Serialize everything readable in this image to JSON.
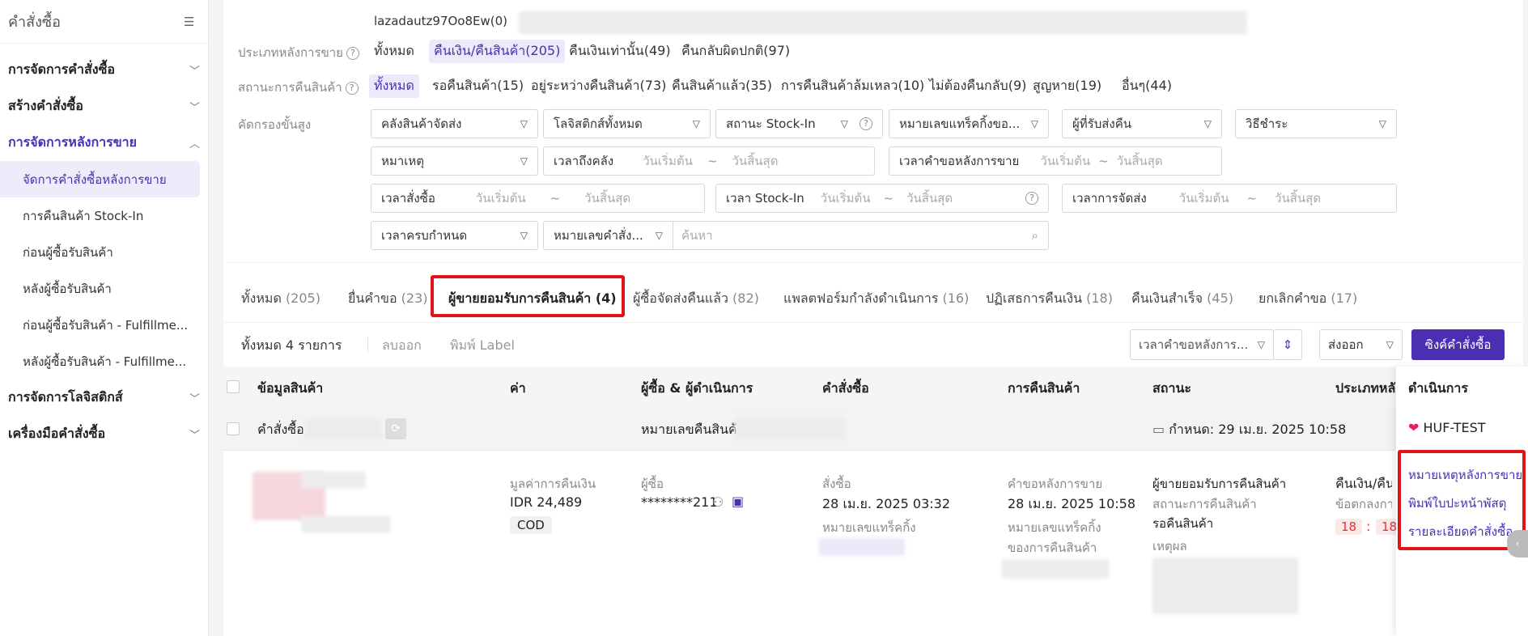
{
  "sidebar": {
    "title": "คำสั่งซื้อ",
    "groups": [
      {
        "label": "การจัดการคำสั่งซื้อ"
      },
      {
        "label": "สร้างคำสั่งซื้อ"
      },
      {
        "label": "การจัดการหลังการขาย"
      },
      {
        "label": "การจัดการโลจิสติกส์"
      },
      {
        "label": "เครื่องมือคำสั่งซื้อ"
      }
    ],
    "items": [
      {
        "label": "จัดการคำสั่งซื้อหลังการขาย"
      },
      {
        "label": "การคืนสินค้า Stock-In"
      },
      {
        "label": "ก่อนผู้ซื้อรับสินค้า"
      },
      {
        "label": "หลังผู้ซื้อรับสินค้า"
      },
      {
        "label": "ก่อนผู้ซื้อรับสินค้า - Fulfillme..."
      },
      {
        "label": "หลังผู้ซื้อรับสินค้า - Fulfillme..."
      }
    ]
  },
  "filters": {
    "store": "lazadautz97Oo8Ew(0)",
    "aftersale_type": {
      "label": "ประเภทหลังการขาย",
      "options": [
        "ทั้งหมด",
        "คืนเงิน/คืนสินค้า(205)",
        "คืนเงินเท่านั้น(49)",
        "คืนกลับผิดปกติ(97)"
      ]
    },
    "return_status": {
      "label": "สถานะการคืนสินค้า",
      "options": [
        "ทั้งหมด",
        "รอคืนสินค้า(15)",
        "อยู่ระหว่างคืนสินค้า(73)",
        "คืนสินค้าแล้ว(35)",
        "การคืนสินค้าล้มเหลว(10)",
        "ไม่ต้องคืนกลับ(9)",
        "สูญหาย(19)",
        "อื่นๆ(44)"
      ]
    },
    "advanced": {
      "label": "คัดกรองขั้นสูง",
      "warehouse": "คลังสินค้าจัดส่ง",
      "logistics": "โลจิสติกส์ทั้งหมด",
      "stockin_status": "สถานะ Stock-In",
      "tracking": "หมายเลขแทร็คกิ้งขอ...",
      "return_receiver": "ผู้ที่รับส่งคืน",
      "payment": "วิธีชำระ",
      "reason": "หมาเหตุ",
      "warehouse_time": "เวลาถึงคลัง",
      "request_time": "เวลาคำขอหลังการขาย",
      "order_time": "เวลาสั่งซื้อ",
      "stockin_time": "เวลา Stock-In",
      "ship_time": "เวลาการจัดส่ง",
      "due_time": "เวลาครบกำหนด",
      "order_no": "หมายเลขคำสั่ง...",
      "search_placeholder": "ค้นหา",
      "date_start": "วันเริ่มต้น",
      "date_end": "วันสิ้นสุด",
      "tilde": "~"
    }
  },
  "tabs": [
    {
      "label": "ทั้งหมด",
      "count": "(205)"
    },
    {
      "label": "ยื่นคำขอ",
      "count": "(23)"
    },
    {
      "label": "ผู้ขายยอมรับการคืนสินค้า",
      "count": "(4)"
    },
    {
      "label": "ผู้ซื้อจัดส่งคืนแล้ว",
      "count": "(82)"
    },
    {
      "label": "แพลตฟอร์มกำลังดำเนินการ",
      "count": "(16)"
    },
    {
      "label": "ปฏิเสธการคืนเงิน",
      "count": "(18)"
    },
    {
      "label": "คืนเงินสำเร็จ",
      "count": "(45)"
    },
    {
      "label": "ยกเลิกคำขอ",
      "count": "(17)"
    }
  ],
  "toolbar": {
    "total": "ทั้งหมด 4 รายการ",
    "delete": "ลบออก",
    "print": "พิมพ์ Label",
    "sort": "เวลาคำขอหลังการ...",
    "export": "ส่งออก",
    "sync": "ซิงค์คำสั่งซื้อ"
  },
  "table": {
    "headers": [
      "ข้อมูลสินค้า",
      "ค่า",
      "ผู้ซื้อ & ผู้ดำเนินการ",
      "คำสั่งซื้อ",
      "การคืนสินค้า",
      "สถานะ",
      "ประเภทหลัง",
      "ดำเนินการ"
    ],
    "group": {
      "order_label": "คำสั่งซื้อ",
      "return_no_label": "หมายเลขคืนสินค้า",
      "deadline": "กำหนด:  29 เม.ย. 2025 10:58",
      "shop": "HUF-TEST"
    },
    "row": {
      "refund_label": "มูลค่าการคืนเงิน",
      "refund_value": "IDR 24,489",
      "payment": "COD",
      "buyer_label": "ผู้ซื้อ",
      "buyer_value": "********211",
      "order_label": "สั่งซื้อ",
      "order_time": "28 เม.ย. 2025 03:32",
      "order_tracking_label": "หมายเลขแทร็คกิ้ง",
      "request_label": "คำขอหลังการขาย",
      "request_time": "28 เม.ย. 2025 10:58",
      "return_tracking_line1": "หมายเลขแทร็คกิ้ง",
      "return_tracking_line2": "ของการคืนสินค้า",
      "status_main": "ผู้ขายยอมรับการคืนสินค้า",
      "status_sub_label": "สถานะการคืนสินค้า",
      "status_sub_value": "รอคืนสินค้า",
      "reason_label": "เหตุผล",
      "type_value": "คืนเงิน/คืน",
      "type_sub": "ข้อตกลงการ",
      "timer_h": "18",
      "timer_sep": ":",
      "timer_m": "18"
    },
    "actions": [
      "หมายเหตุหลังการขาย",
      "พิมพ์ใบปะหน้าพัสดุ",
      "รายละเอียดคำสั่งซื้อ"
    ]
  },
  "colors": {
    "accent": "#4a2fb2",
    "highlight": "#e0151a"
  }
}
